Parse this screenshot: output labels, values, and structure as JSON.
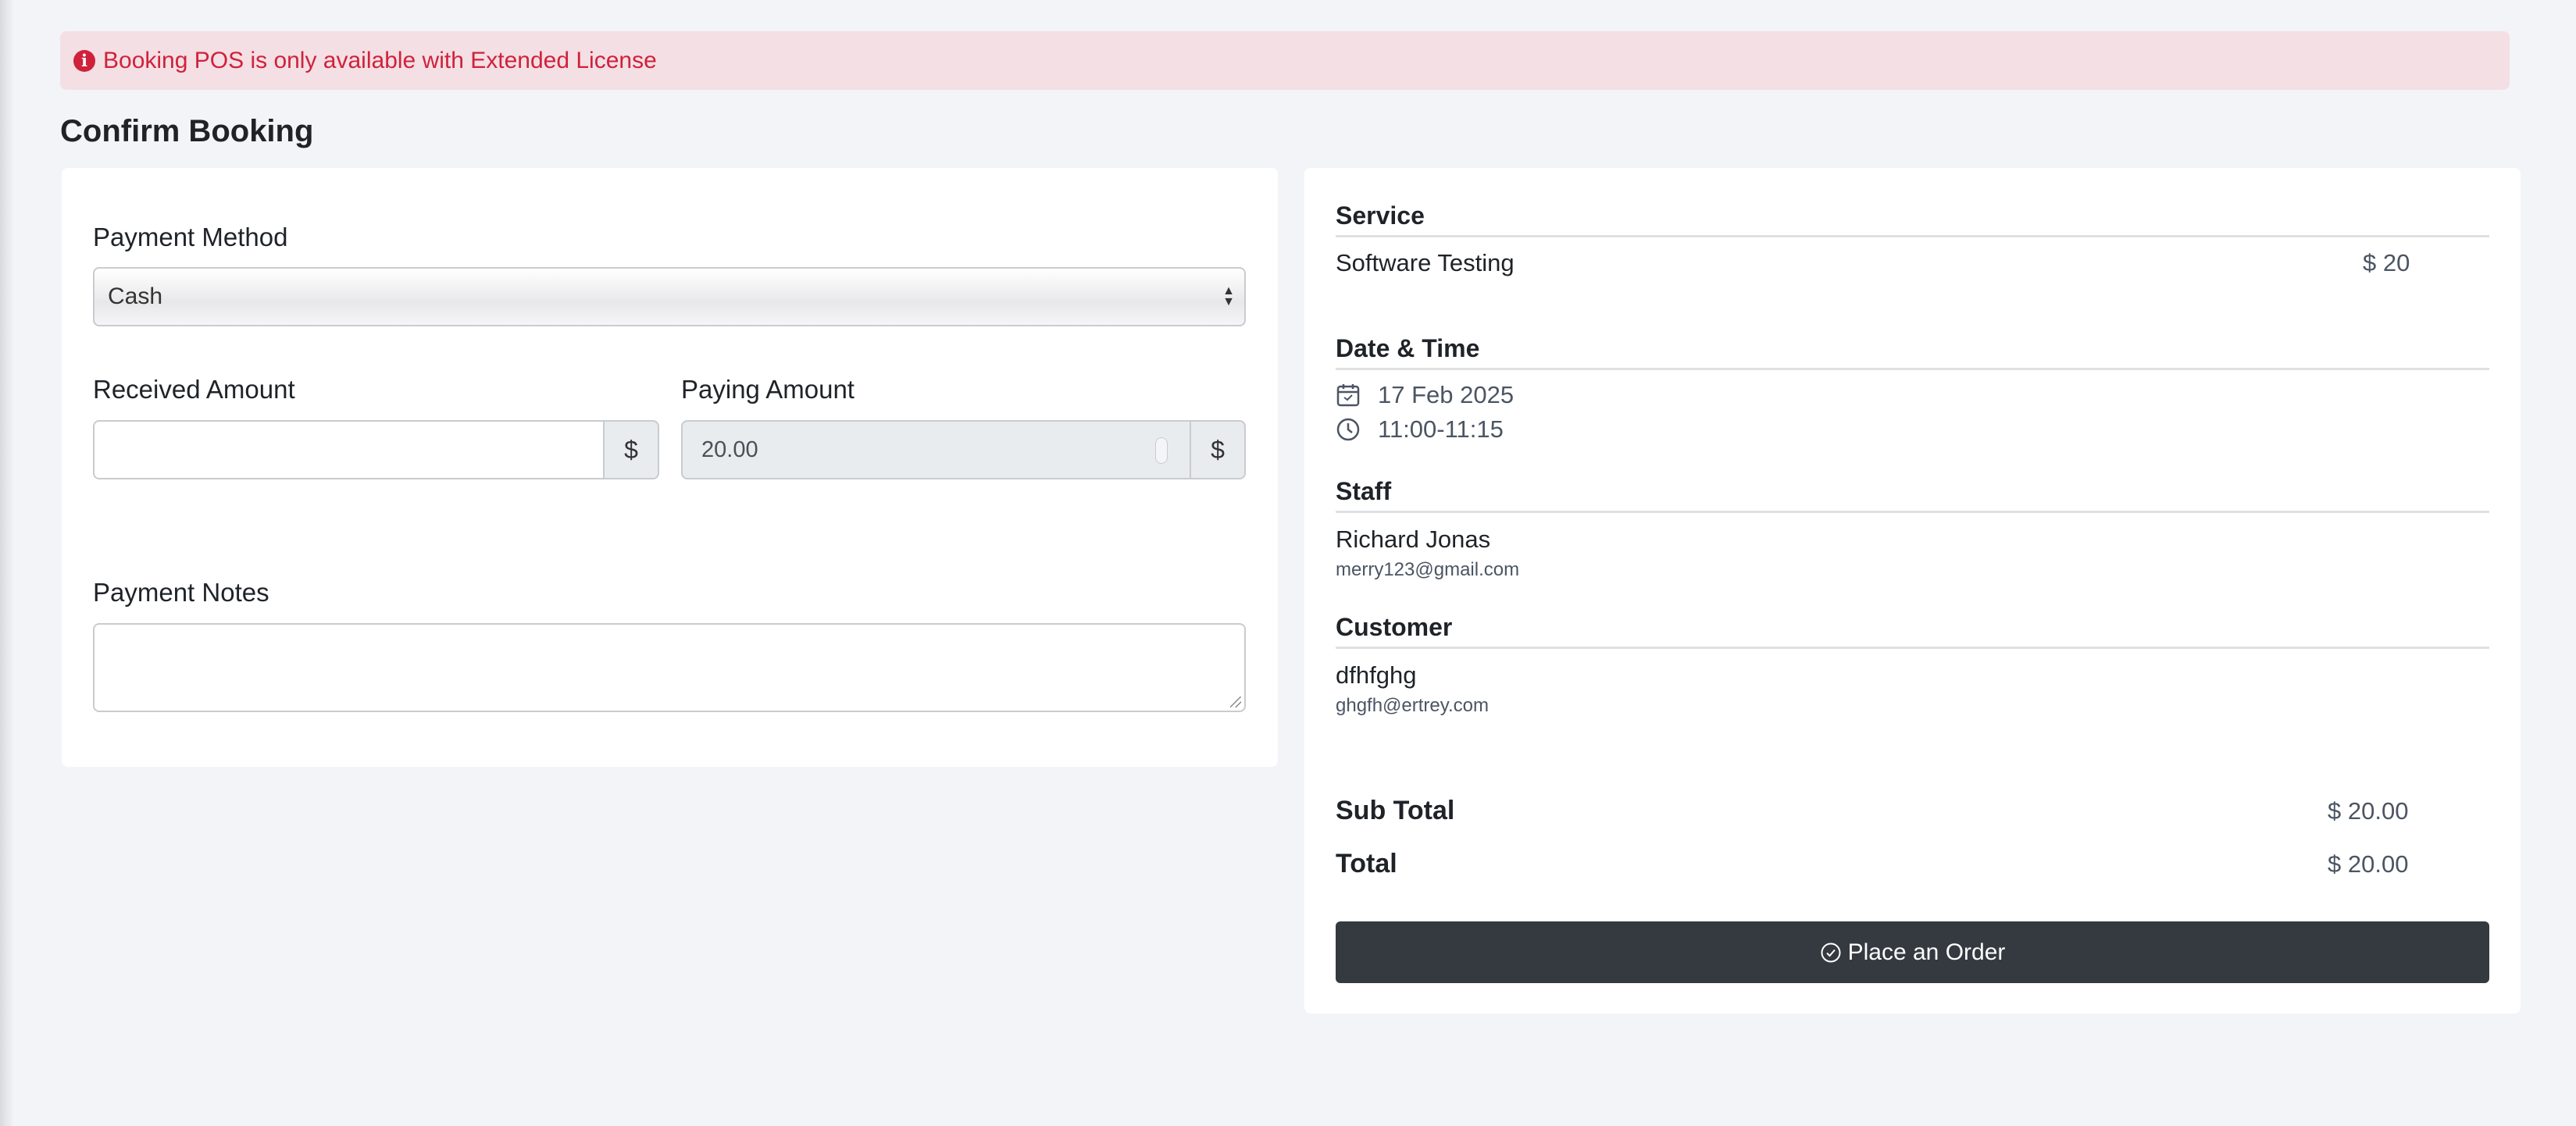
{
  "alert": {
    "text": "Booking POS is only available with Extended License",
    "icon": "info-icon"
  },
  "page": {
    "title": "Confirm Booking"
  },
  "payment_form": {
    "payment_method_label": "Payment Method",
    "payment_method_value": "Cash",
    "received_amount_label": "Received Amount",
    "received_amount_value": "",
    "received_currency": "$",
    "paying_amount_label": "Paying Amount",
    "paying_amount_value": "20.00",
    "paying_currency": "$",
    "payment_notes_label": "Payment Notes",
    "payment_notes_value": ""
  },
  "summary": {
    "service_title": "Service",
    "service_name": "Software Testing",
    "service_price": "$ 20",
    "datetime_title": "Date & Time",
    "date": "17 Feb 2025",
    "time": "11:00-11:15",
    "staff_title": "Staff",
    "staff_name": "Richard Jonas",
    "staff_email": "merry123@gmail.com",
    "customer_title": "Customer",
    "customer_name": "dfhfghg",
    "customer_email": "ghgfh@ertrey.com",
    "subtotal_label": "Sub Total",
    "subtotal_value": "$ 20.00",
    "total_label": "Total",
    "total_value": "$ 20.00",
    "order_button": "Place an Order"
  },
  "colors": {
    "alert_bg": "#f3dfe4",
    "alert_text": "#d0213b",
    "button_bg": "#343a40"
  }
}
